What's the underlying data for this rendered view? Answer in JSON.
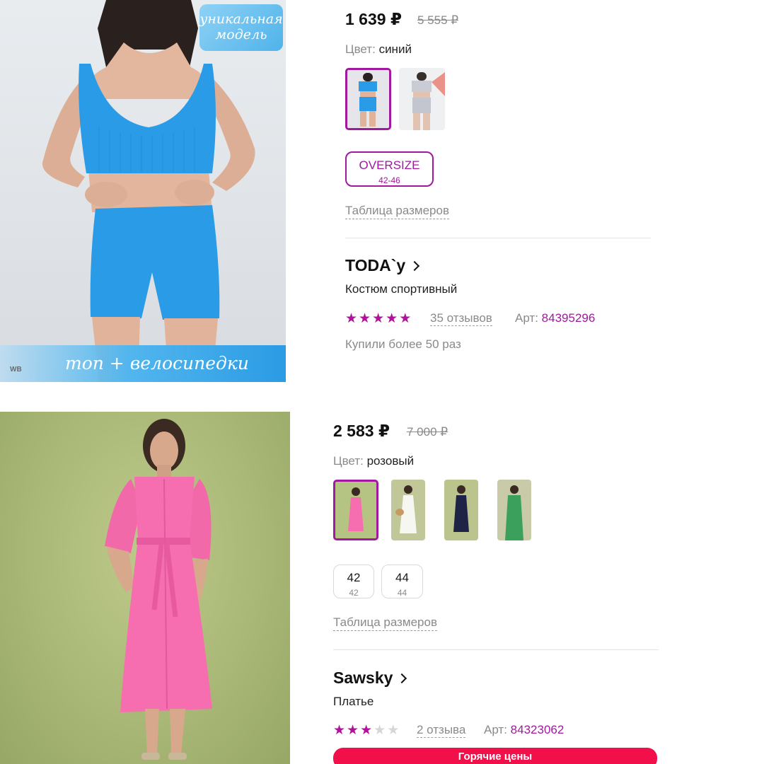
{
  "colors": {
    "accent": "#a0199f",
    "star": "#b0139b",
    "hot": "#f1104a",
    "muted": "#8a8a8a"
  },
  "product1": {
    "photo": {
      "badge_line1": "уникальная",
      "badge_line2": "модель",
      "caption": "топ + велосипедки",
      "watermark": "WB"
    },
    "price": "1 639 ₽",
    "old_price": "5 555 ₽",
    "color_label": "Цвет:",
    "color_value": "синий",
    "sizes": [
      {
        "label": "OVERSIZE",
        "sub": "42-46"
      }
    ],
    "size_table": "Таблица размеров",
    "brand": "TODA`y",
    "name": "Костюм спортивный",
    "rating": 5,
    "reviews": "35 отзывов",
    "art_label": "Арт:",
    "art_number": "84395296",
    "bought": "Купили более 50 раз"
  },
  "product2": {
    "price": "2 583 ₽",
    "old_price": "7 000 ₽",
    "color_label": "Цвет:",
    "color_value": "розовый",
    "sizes": [
      {
        "label": "42",
        "sub": "42"
      },
      {
        "label": "44",
        "sub": "44"
      }
    ],
    "size_table": "Таблица размеров",
    "brand": "Sawsky",
    "name": "Платье",
    "rating": 3,
    "reviews": "2 отзыва",
    "art_label": "Арт:",
    "art_number": "84323062",
    "hot_badge": "Горячие цены"
  }
}
